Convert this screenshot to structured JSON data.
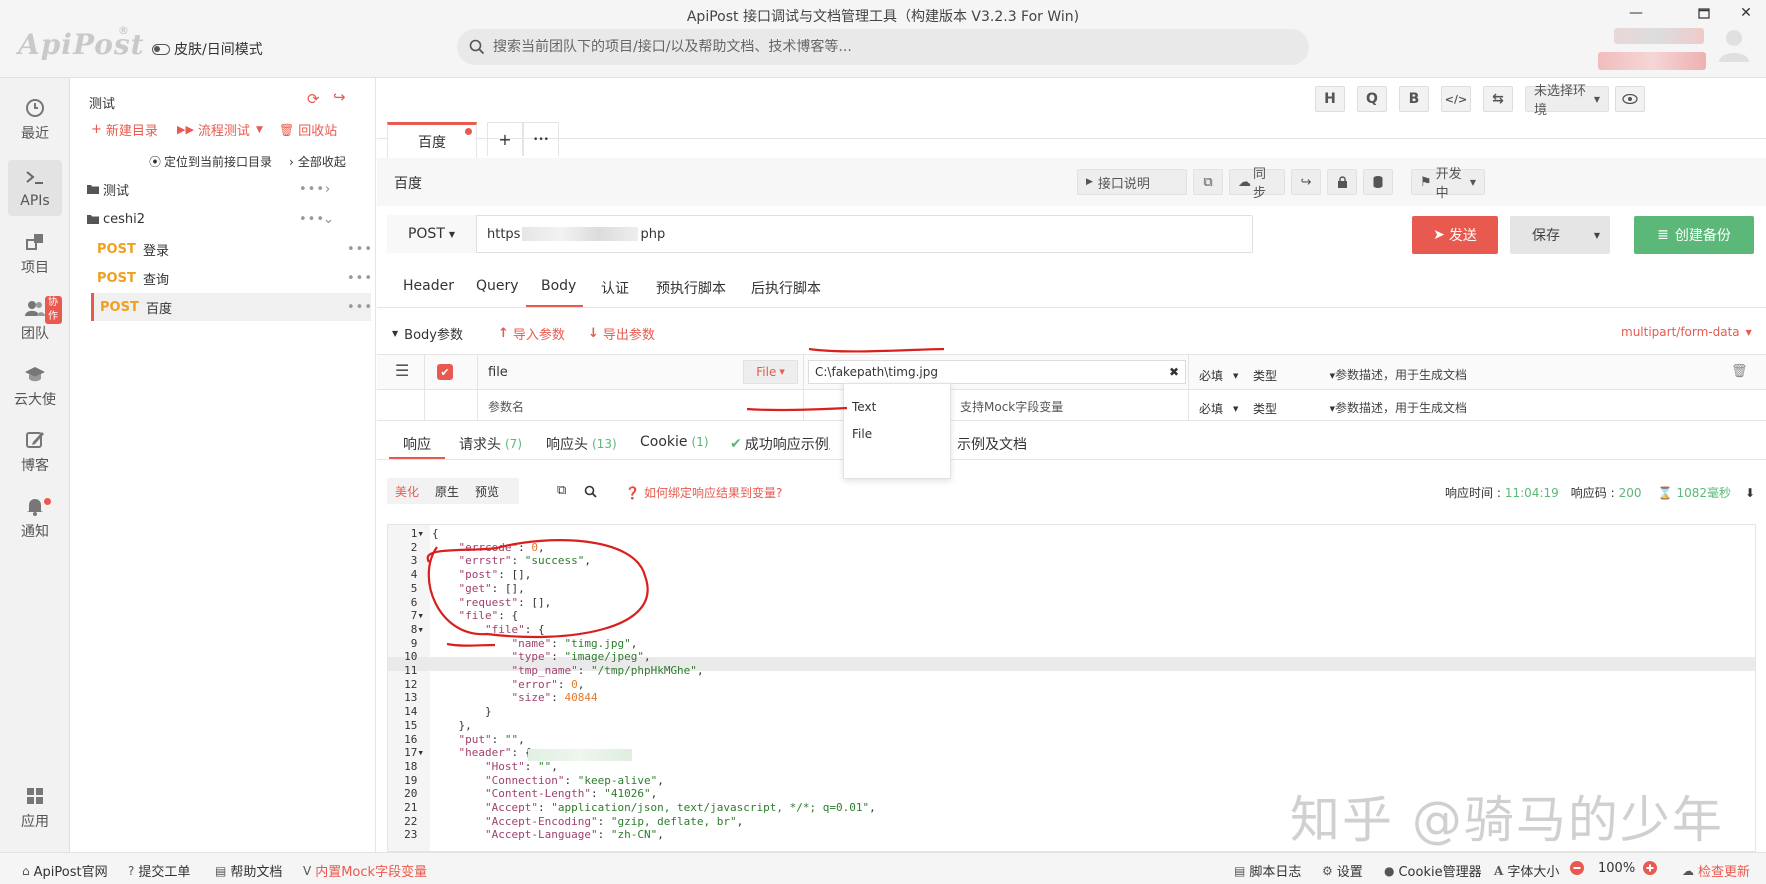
{
  "window": {
    "title": "ApiPost 接口调试与文档管理工具（构建版本 V3.2.3 For Win)",
    "logo": "ApiPost",
    "logo_mark": "®",
    "skin_toggle": "皮肤/日间模式",
    "search_placeholder": "搜索当前团队下的项目/接口/以及帮助文档、技术博客等..."
  },
  "leftnav": {
    "items": [
      {
        "label": "最近",
        "icon": "clock-icon"
      },
      {
        "label": "APIs",
        "icon": "terminal-icon"
      },
      {
        "label": "项目",
        "icon": "project-icon"
      },
      {
        "label": "团队",
        "icon": "team-icon",
        "badge": "协作"
      },
      {
        "label": "云大使",
        "icon": "graduation-cap-icon"
      },
      {
        "label": "博客",
        "icon": "edit-icon"
      },
      {
        "label": "通知",
        "icon": "bell-icon"
      },
      {
        "label": "应用",
        "icon": "apps-grid-icon"
      }
    ]
  },
  "tree": {
    "project_name": "测试",
    "actions": {
      "new_dir": "新建目录",
      "flow_test": "流程测试",
      "recycle": "回收站"
    },
    "locate": "定位到当前接口目录",
    "collapse_all": "全部收起",
    "folders": [
      {
        "name": "测试"
      },
      {
        "name": "ceshi2"
      }
    ],
    "apis": [
      {
        "method": "POST",
        "name": "登录"
      },
      {
        "method": "POST",
        "name": "查询"
      },
      {
        "method": "POST",
        "name": "百度"
      }
    ]
  },
  "toolbar": {
    "buttons": [
      "H",
      "Q",
      "B",
      "</>",
      "⇆"
    ],
    "env": "未选择环境"
  },
  "tabs": {
    "active": "百度",
    "add": "+",
    "more": "•••"
  },
  "api": {
    "name": "百度",
    "doc_btn": "接口说明",
    "sync_btn": "同步",
    "status": "开发中",
    "method": "POST",
    "url_prefix": "https",
    "url_suffix": "php",
    "send": "发送",
    "save": "保存",
    "backup": "创建备份"
  },
  "req_tabs": [
    "Header",
    "Query",
    "Body",
    "认证",
    "预执行脚本",
    "后执行脚本"
  ],
  "body": {
    "label": "Body参数",
    "import": "导入参数",
    "export": "导出参数",
    "content_type": "multipart/form-data",
    "rows": [
      {
        "key": "file",
        "type_btn": "File",
        "value": "C:\\fakepath\\timg.jpg",
        "required": "必填",
        "type": "类型",
        "desc": "参数描述，用于生成文档"
      },
      {
        "key_placeholder": "参数名",
        "value_placeholder": "支持Mock字段变量",
        "required": "必填",
        "type": "类型",
        "desc": "参数描述，用于生成文档"
      }
    ],
    "dropdown": [
      "Text",
      "File"
    ]
  },
  "resp_tabs": [
    {
      "label": "响应"
    },
    {
      "label": "请求头",
      "count": "(7)"
    },
    {
      "label": "响应头",
      "count": "(13)"
    },
    {
      "label": "Cookie",
      "count": "(1)"
    },
    {
      "label": "成功响应示例及文"
    },
    {
      "label": "示例及文档"
    }
  ],
  "resp_view": {
    "modes": [
      "美化",
      "原生",
      "预览"
    ],
    "bind_tip": "如何绑定响应结果到变量?",
    "time_label": "响应时间 :",
    "time": "11:04:19",
    "code_label": "响应码 :",
    "code": "200",
    "duration": "1082毫秒"
  },
  "code_lines": [
    "{",
    "    \"errcode\": 0,",
    "    \"errstr\": \"success\",",
    "    \"post\": [],",
    "    \"get\": [],",
    "    \"request\": [],",
    "    \"file\": {",
    "        \"file\": {",
    "            \"name\": \"timg.jpg\",",
    "            \"type\": \"image/jpeg\",",
    "            \"tmp_name\": \"/tmp/phpHkMGhe\",",
    "            \"error\": 0,",
    "            \"size\": 40844",
    "        }",
    "    },",
    "    \"put\": \"\",",
    "    \"header\": {",
    "        \"Host\": \"\",",
    "        \"Connection\": \"keep-alive\",",
    "        \"Content-Length\": \"41026\",",
    "        \"Accept\": \"application/json, text/javascript, */*; q=0.01\",",
    "        \"Accept-Encoding\": \"gzip, deflate, br\",",
    "        \"Accept-Language\": \"zh-CN\","
  ],
  "footer": {
    "left": [
      "ApiPost官网",
      "提交工单",
      "帮助文档",
      "内置Mock字段变量"
    ],
    "right": {
      "script_log": "脚本日志",
      "settings": "设置",
      "cookie": "Cookie管理器",
      "font": "字体大小",
      "zoom": "100%",
      "update": "检查更新"
    }
  },
  "watermark": "知乎 @骑马的少年",
  "colors": {
    "accent": "#e85a4f",
    "green": "#5bb878",
    "post": "#f0a020"
  }
}
